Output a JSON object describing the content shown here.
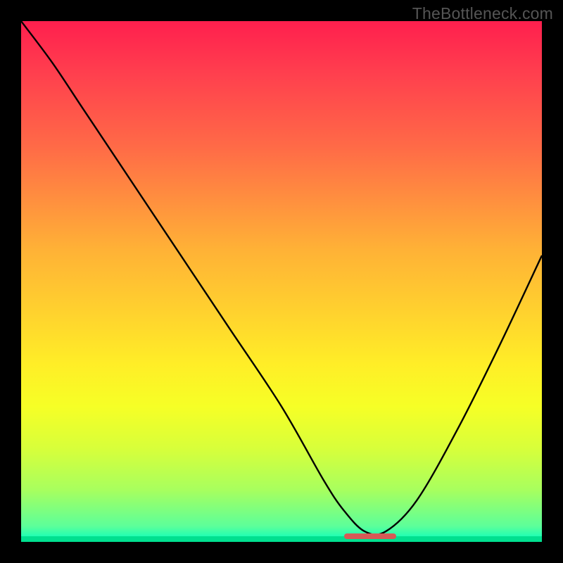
{
  "watermark": "TheBottleneck.com",
  "chart_data": {
    "type": "line",
    "title": "",
    "xlabel": "",
    "ylabel": "",
    "xlim": [
      0,
      100
    ],
    "ylim": [
      0,
      100
    ],
    "grid": false,
    "legend": false,
    "background_gradient": {
      "direction": "vertical",
      "stops": [
        {
          "pos": 0,
          "color": "#ff1f4e"
        },
        {
          "pos": 24,
          "color": "#ff6a47"
        },
        {
          "pos": 44,
          "color": "#ffb236"
        },
        {
          "pos": 66,
          "color": "#ffee27"
        },
        {
          "pos": 82,
          "color": "#d8ff3a"
        },
        {
          "pos": 97,
          "color": "#5cff9a"
        },
        {
          "pos": 100,
          "color": "#00ffc0"
        }
      ]
    },
    "series": [
      {
        "name": "bottleneck-curve",
        "color": "#000000",
        "x": [
          0,
          6,
          12,
          20,
          30,
          40,
          50,
          58,
          62,
          66,
          70,
          76,
          84,
          92,
          100
        ],
        "values": [
          100,
          92,
          83,
          71,
          56,
          41,
          26,
          12,
          6,
          2,
          2,
          8,
          22,
          38,
          55
        ]
      }
    ],
    "flat_region": {
      "x_start": 62,
      "x_end": 72,
      "color": "#d65a56"
    }
  }
}
